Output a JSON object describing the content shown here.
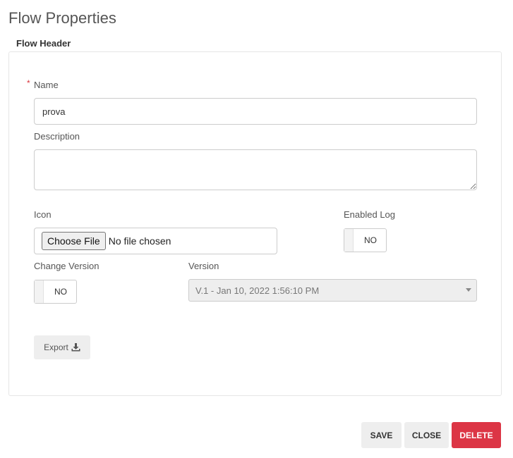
{
  "page": {
    "title": "Flow Properties",
    "section_title": "Flow Header"
  },
  "form": {
    "name_required_mark": "*",
    "name_label": "Name",
    "name_value": "prova",
    "description_label": "Description",
    "description_value": "",
    "icon_label": "Icon",
    "file_button_label": "Choose File",
    "file_status": "No file chosen",
    "enabled_log_label": "Enabled Log",
    "enabled_log_value": "NO",
    "change_version_label": "Change Version",
    "change_version_value": "NO",
    "version_label": "Version",
    "version_selected": "V.1 - Jan 10, 2022 1:56:10 PM",
    "export_label": "Export"
  },
  "actions": {
    "save_label": "SAVE",
    "close_label": "CLOSE",
    "delete_label": "DELETE"
  },
  "icons": {
    "export": "download-icon",
    "select": "caret-down-icon"
  },
  "colors": {
    "delete": "#dc3545",
    "required": "#d9363e",
    "button_bg": "#eeeeee"
  }
}
